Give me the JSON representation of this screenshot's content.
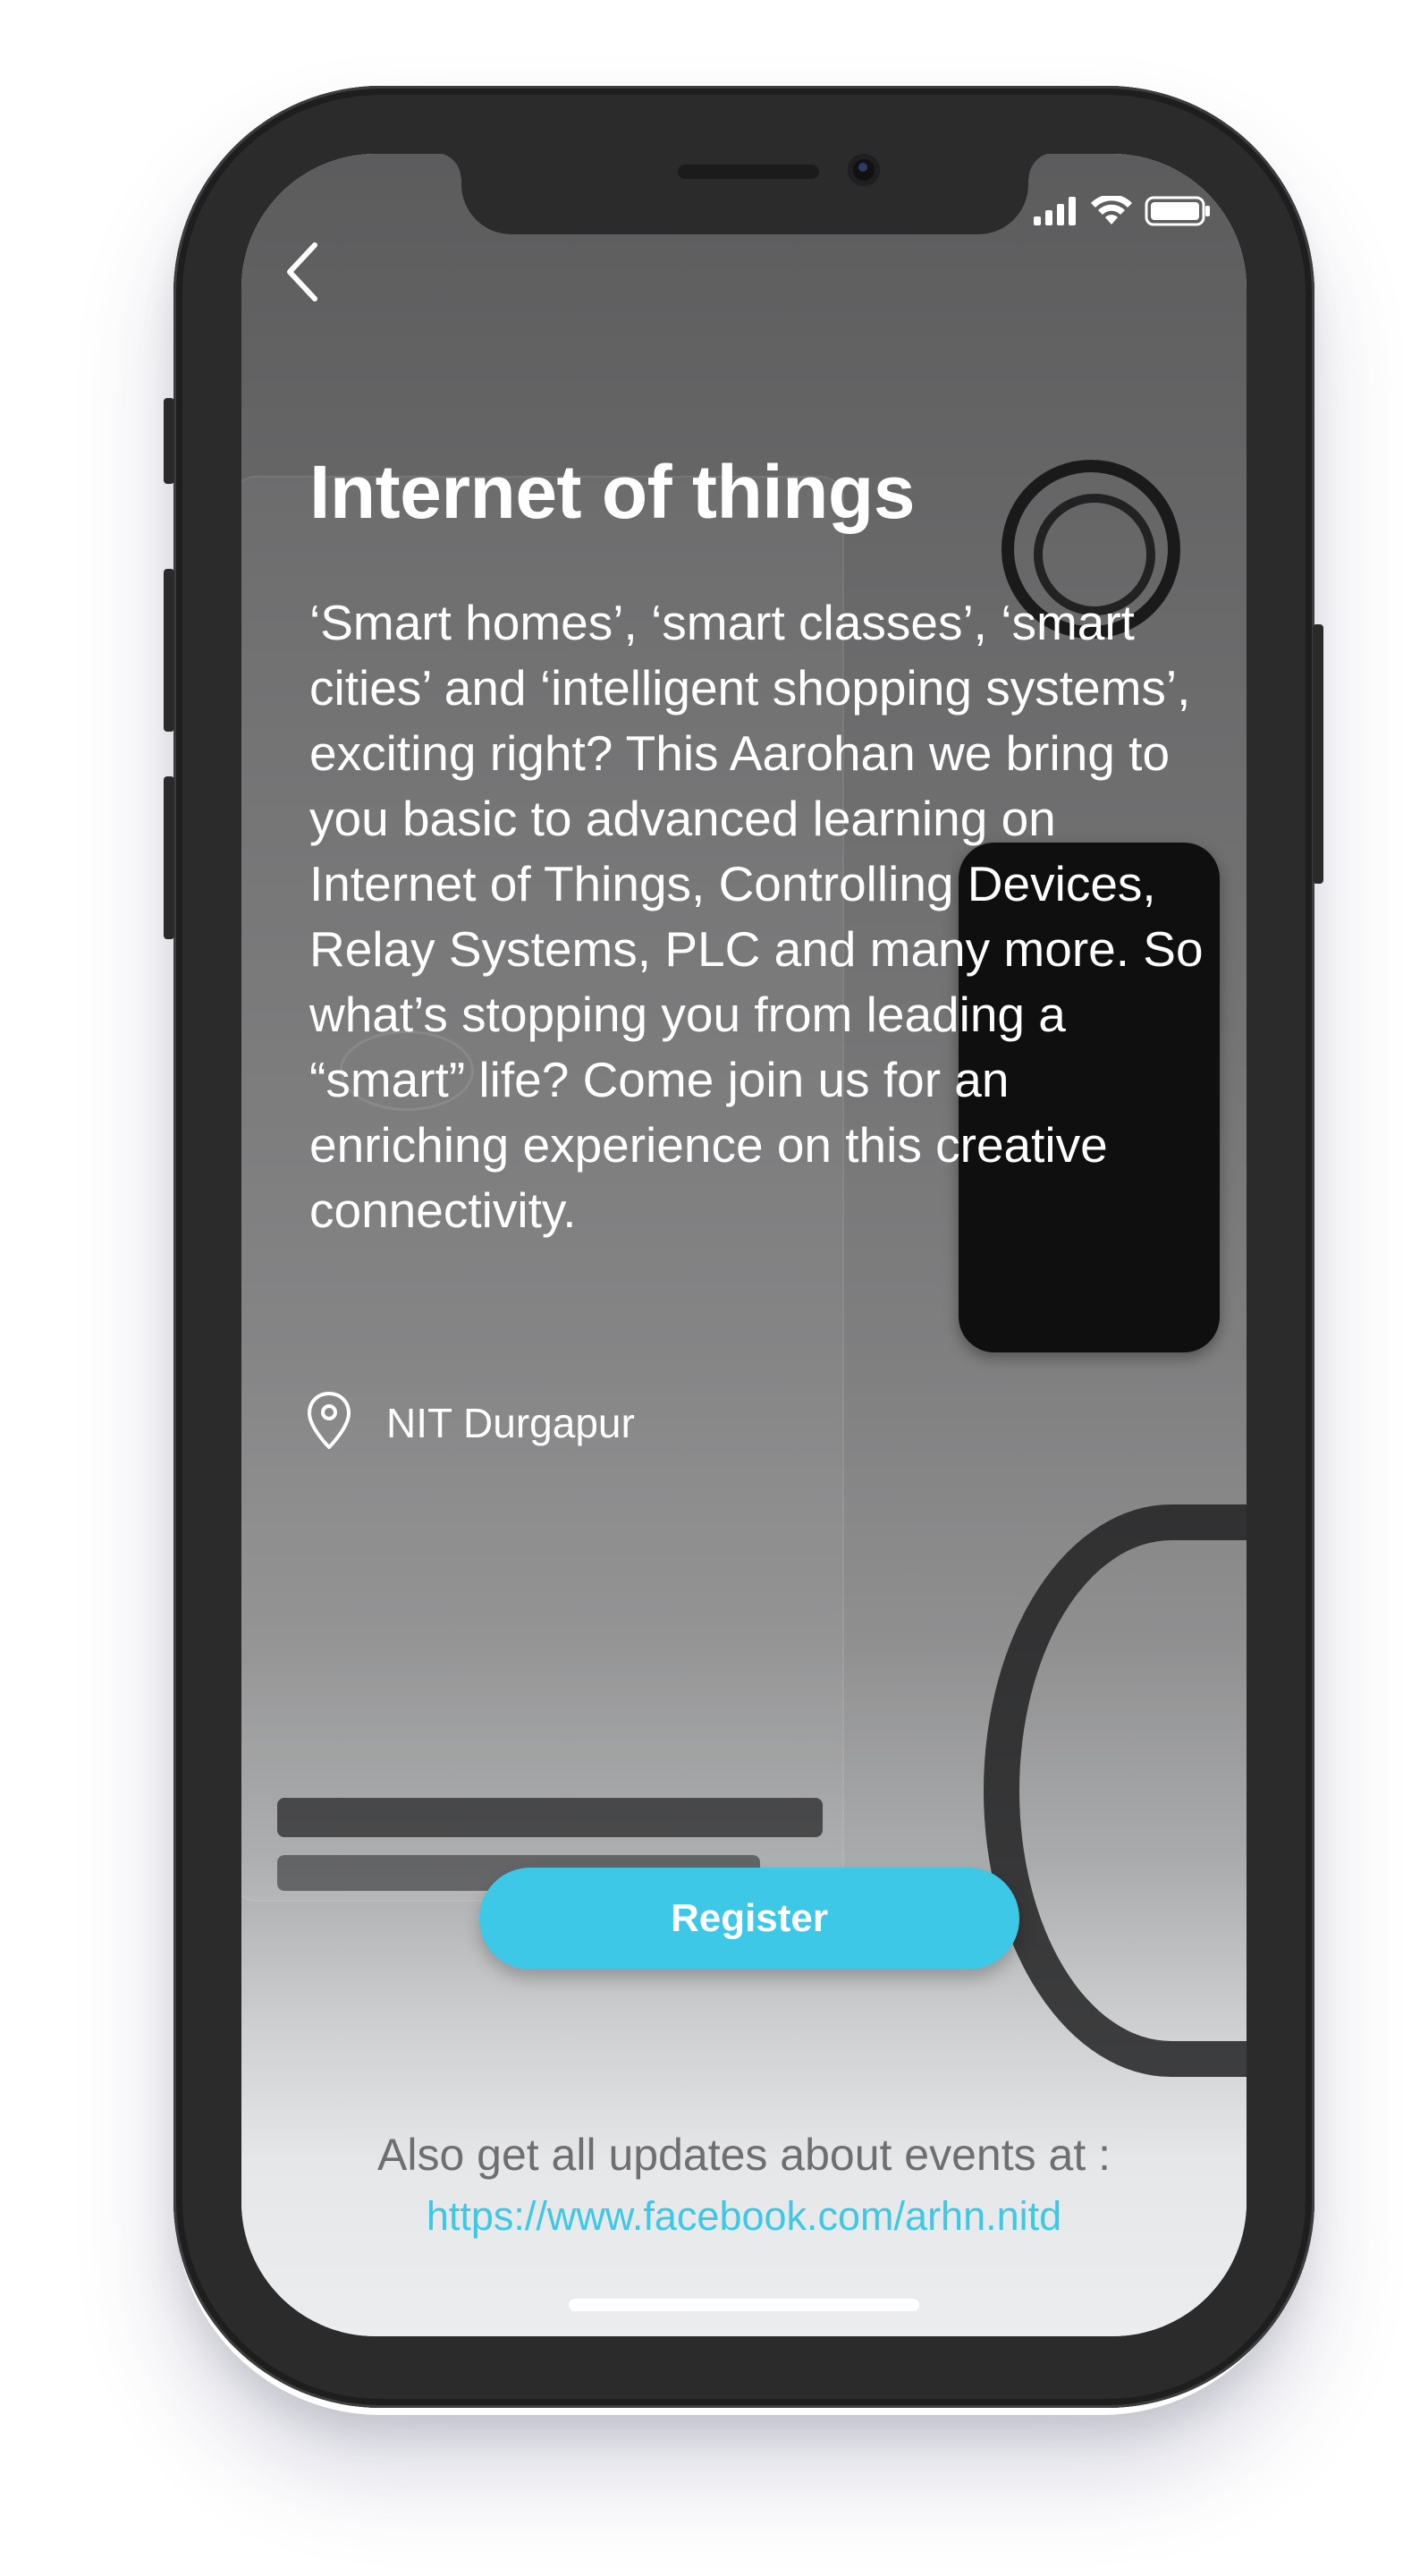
{
  "status_bar": {
    "icons": [
      "signal-bars-icon",
      "wifi-icon",
      "battery-icon"
    ]
  },
  "nav": {
    "back_icon": "chevron-left-icon"
  },
  "event": {
    "title": "Internet of things",
    "description": "‘Smart homes’, ‘smart classes’, ‘smart cities’ and ‘intelligent shopping systems’, exciting right? This Aarohan we bring to you basic to advanced learning on Internet of Things, Controlling Devices, Relay Systems, PLC and many more. So what’s stopping you from leading a “smart” life? Come join us for an enriching experience on this creative connectivity.",
    "location": "NIT Durgapur",
    "location_icon": "map-pin-icon"
  },
  "actions": {
    "register_label": "Register"
  },
  "footer": {
    "updates_text": "Also get all updates about events at :",
    "link_text": "https://www.facebook.com/arhn.nitd"
  },
  "colors": {
    "accent": "#3ec8e8",
    "phone_frame": "#2b2b2c",
    "footer_text": "#6f6f71"
  }
}
